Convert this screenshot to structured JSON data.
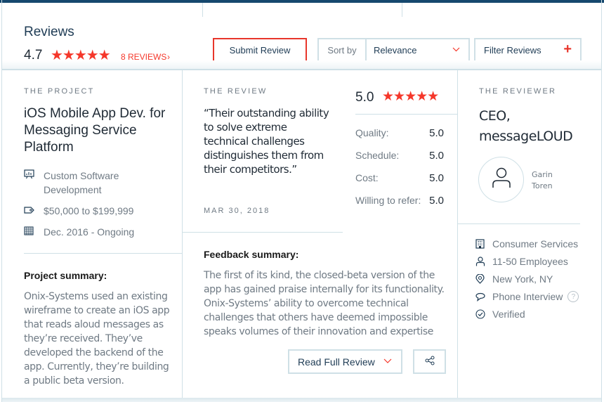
{
  "header": {
    "title": "Reviews",
    "overall_score": "4.7",
    "stars": "★★★★★",
    "reviews_link": "8 REVIEWS",
    "reviews_chevron": "›",
    "submit_label": "Submit Review",
    "sort_label": "Sort by",
    "sort_value": "Relevance",
    "filter_label": "Filter Reviews",
    "filter_plus": "+",
    "accent_color": "#f5372a",
    "brand_color": "#16486e"
  },
  "project": {
    "eyebrow": "THE PROJECT",
    "title": "iOS Mobile App Dev. for Messaging Service Platform",
    "meta": [
      {
        "icon": "presentation-icon",
        "text": "Custom Software Development"
      },
      {
        "icon": "price-tag-icon",
        "text": "$50,000 to $199,999"
      },
      {
        "icon": "calendar-icon",
        "text": "Dec. 2016 - Ongoing"
      }
    ],
    "summary_heading": "Project summary:",
    "summary_text": "Onix-Systems used an existing wireframe to create an iOS app that reads aloud messages as they’re received. They’ve developed the backend of the app. Currently, they’re building a public beta version."
  },
  "review": {
    "eyebrow": "THE REVIEW",
    "quote": "“Their outstanding ability to solve extreme technical challenges distinguishes them from their competitors.”",
    "date": "MAR 30, 2018",
    "score": "5.0",
    "stars": "★★★★★",
    "ratings": [
      {
        "label": "Quality:",
        "value": "5.0"
      },
      {
        "label": "Schedule:",
        "value": "5.0"
      },
      {
        "label": "Cost:",
        "value": "5.0"
      },
      {
        "label": "Willing to refer:",
        "value": "5.0"
      }
    ],
    "feedback_heading": "Feedback summary:",
    "feedback_text": "The first of its kind, the closed-beta version of the app has gained praise internally for its functionality. Onix-Systems’ ability to overcome technical challenges that others have deemed impossible speaks volumes of their innovation and expertise",
    "read_full_label": "Read Full Review"
  },
  "reviewer": {
    "eyebrow": "THE REVIEWER",
    "title": "CEO, messageLOUD",
    "name": "Garin Toren",
    "details": [
      {
        "icon": "building-icon",
        "text": "Consumer Services"
      },
      {
        "icon": "person-icon",
        "text": "11-50 Employees"
      },
      {
        "icon": "location-pin-icon",
        "text": "New York, NY"
      },
      {
        "icon": "speech-bubble-icon",
        "text": "Phone Interview"
      },
      {
        "icon": "check-circle-icon",
        "text": "Verified"
      }
    ],
    "help_glyph": "?"
  }
}
